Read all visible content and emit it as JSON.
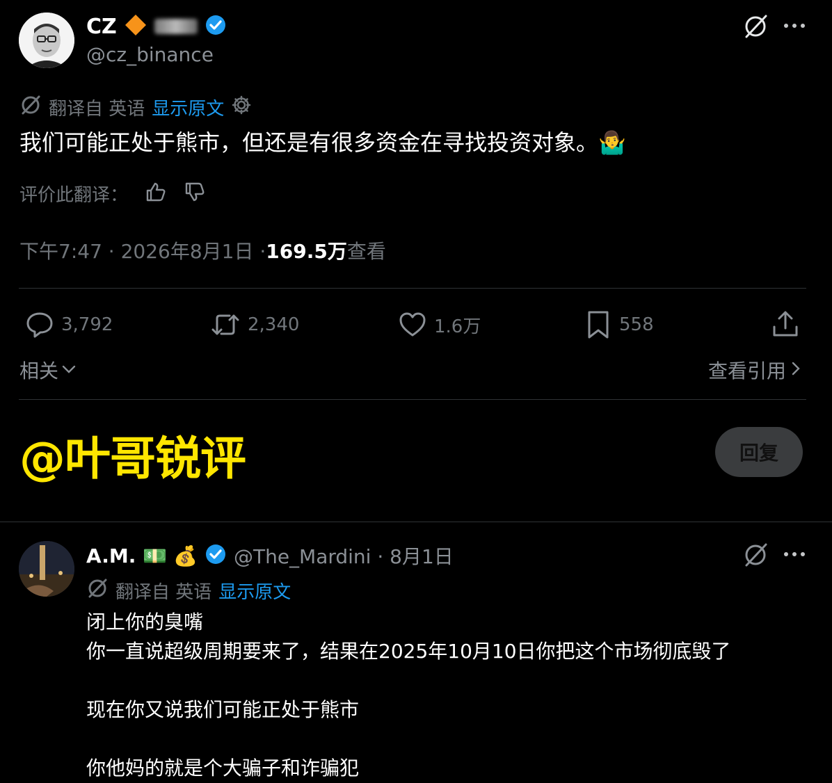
{
  "tweet": {
    "display_name": "CZ",
    "handle": "@cz_binance",
    "translation_bar": {
      "prefix": "翻译自 英语",
      "show_original": "显示原文"
    },
    "text": "我们可能正处于熊市，但还是有很多资金在寻找投资对象。🤷‍♂️",
    "rate_label": "评价此翻译：",
    "meta": {
      "time": "下午7:47 · 2026年8月1日 · ",
      "views_count": "169.5万",
      "views_label": " 查看"
    },
    "stats": {
      "replies": "3,792",
      "retweets": "2,340",
      "likes": "1.6万",
      "bookmarks": "558"
    },
    "related_label": "相关",
    "quotes_label": "查看引用"
  },
  "composer": {
    "overlay_text": "@叶哥锐评",
    "reply_button": "回复"
  },
  "reply": {
    "display_name": "A.M.",
    "emojis": "💵 💰",
    "handle_date": "@The_Mardini · 8月1日",
    "translation_bar": {
      "prefix": "翻译自 英语",
      "show_original": "显示原文"
    },
    "lines": [
      "闭上你的臭嘴",
      "你一直说超级周期要来了，结果在2025年10月10日你把这个市场彻底毁了",
      "",
      "现在你又说我们可能正处于熊市",
      "",
      "你他妈的就是个大骗子和诈骗犯"
    ]
  },
  "colors": {
    "background": "#000000",
    "text": "#e7e9ea",
    "muted": "#71767b",
    "accent_blue": "#1d9bf0",
    "overlay_yellow": "#ffe600"
  }
}
